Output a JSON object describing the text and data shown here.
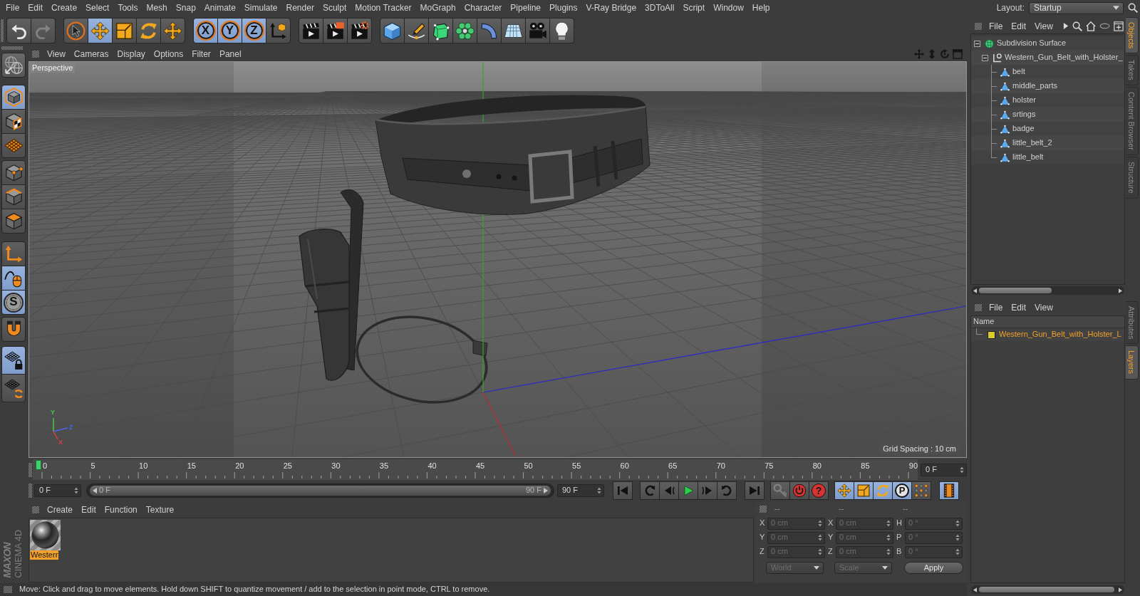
{
  "menu_bar": {
    "items": [
      "File",
      "Edit",
      "Create",
      "Select",
      "Tools",
      "Mesh",
      "Snap",
      "Animate",
      "Simulate",
      "Render",
      "Sculpt",
      "Motion Tracker",
      "MoGraph",
      "Character",
      "Pipeline",
      "Plugins",
      "V-Ray Bridge",
      "3DToAll",
      "Script",
      "Window",
      "Help"
    ],
    "layout_label": "Layout:",
    "layout_value": "Startup"
  },
  "top_toolbar": [
    [
      {
        "on": false,
        "disabled": false
      },
      {
        "on": false,
        "disabled": true
      }
    ],
    [
      {
        "on": false,
        "disabled": false
      },
      {
        "on": true,
        "disabled": false
      },
      {
        "on": false,
        "disabled": false
      },
      {
        "on": false,
        "disabled": false
      },
      {
        "on": false,
        "disabled": false
      }
    ],
    [
      {
        "label": "X",
        "on": true,
        "disabled": false
      },
      {
        "label": "Y",
        "on": true,
        "disabled": false
      },
      {
        "label": "Z",
        "on": true,
        "disabled": false
      },
      {
        "on": false,
        "disabled": false
      }
    ],
    [
      {
        "on": false,
        "disabled": false
      },
      {
        "on": false,
        "disabled": false
      },
      {
        "on": false,
        "disabled": false
      }
    ],
    [
      {
        "on": false,
        "disabled": false
      },
      {
        "on": false,
        "disabled": false
      },
      {
        "on": false,
        "disabled": false
      },
      {
        "on": false,
        "disabled": false
      },
      {
        "on": false,
        "disabled": false
      },
      {
        "on": false,
        "disabled": false
      },
      {
        "on": false,
        "disabled": false
      },
      {
        "on": false,
        "disabled": false
      }
    ]
  ],
  "left_toolbar": [
    [
      {
        "on": false
      }
    ],
    [
      {
        "on": true
      },
      {
        "on": false
      },
      {
        "on": false
      }
    ],
    [
      {
        "on": false
      },
      {
        "on": false
      },
      {
        "on": false
      }
    ],
    [
      {
        "on": false
      },
      {
        "on": true
      },
      {
        "label": "S",
        "on": true
      }
    ],
    [
      {
        "on": false
      }
    ],
    [
      {
        "on": true
      },
      {
        "on": false
      }
    ]
  ],
  "viewport": {
    "menu": [
      "View",
      "Cameras",
      "Display",
      "Options",
      "Filter",
      "Panel"
    ],
    "camera": "Perspective",
    "grid_spacing": "Grid Spacing : 10 cm",
    "gizmo_labels": [
      {
        "text": "Y",
        "color": "#46c846"
      },
      {
        "text": "Z",
        "color": "#4a64f0"
      },
      {
        "text": "X",
        "color": "#dc3c3c"
      }
    ]
  },
  "object_manager": {
    "menu": [
      "File",
      "Edit",
      "View"
    ],
    "objects": [
      {
        "name": "Subdivision Surface",
        "kind": "subdivision",
        "selected": false,
        "expanded": true,
        "children": [
          {
            "name": "Western_Gun_Belt_with_Holster_",
            "kind": "null",
            "selected": false,
            "expanded": true,
            "children": [
              {
                "name": "belt",
                "kind": "polygon",
                "selected": false
              },
              {
                "name": "middle_parts",
                "kind": "polygon",
                "selected": false
              },
              {
                "name": "holster",
                "kind": "polygon",
                "selected": false
              },
              {
                "name": "srtings",
                "kind": "polygon",
                "selected": false
              },
              {
                "name": "badge",
                "kind": "polygon",
                "selected": false
              },
              {
                "name": "little_belt_2",
                "kind": "polygon",
                "selected": false
              },
              {
                "name": "little_belt",
                "kind": "polygon",
                "selected": false
              }
            ]
          }
        ]
      }
    ]
  },
  "side_tabs": {
    "upper": [
      {
        "label": "Objects",
        "selected": true
      },
      {
        "label": "Takes",
        "selected": false
      },
      {
        "label": "Content Browser",
        "selected": false
      },
      {
        "label": "Structure",
        "selected": false
      }
    ],
    "lower": [
      {
        "label": "Attributes",
        "selected": false
      },
      {
        "label": "Layers",
        "selected": true
      }
    ]
  },
  "layer_manager": {
    "menu": [
      "File",
      "Edit",
      "View"
    ],
    "column": "Name",
    "layers": [
      {
        "name": "Western_Gun_Belt_with_Holster_L",
        "color": "#d8cb2a",
        "selected": true
      }
    ]
  },
  "timeline": {
    "labels": [
      "0",
      "5",
      "10",
      "15",
      "20",
      "25",
      "30",
      "35",
      "40",
      "45",
      "50",
      "55",
      "60",
      "65",
      "70",
      "75",
      "80",
      "85",
      "90"
    ],
    "level": 0,
    "frame_field": "0 F"
  },
  "playback": {
    "min_field": "0 F",
    "range": {
      "start": "0 F",
      "end": "90 F",
      "level": 1
    },
    "max_field": "90 F",
    "key_buttons": [
      [
        {
          "on": false,
          "disabled": true
        },
        {
          "on": false,
          "disabled": false
        },
        {
          "label": "?",
          "on": false,
          "disabled": false
        }
      ],
      [
        {
          "on": true,
          "disabled": false
        },
        {
          "on": true,
          "disabled": false
        },
        {
          "on": true,
          "disabled": false
        },
        {
          "label": "P",
          "on": true,
          "disabled": false
        },
        {
          "on": false,
          "disabled": false
        }
      ],
      [
        {
          "on": true,
          "disabled": false
        }
      ]
    ]
  },
  "material_manager": {
    "menu": [
      "Create",
      "Edit",
      "Function",
      "Texture"
    ],
    "materials": [
      {
        "name": "Westerr",
        "selected": true
      }
    ]
  },
  "coordinates": {
    "headers": [
      "--",
      "--",
      "--"
    ],
    "disabled": true,
    "rows": [
      [
        {
          "axis": "X",
          "value": "0 cm"
        },
        {
          "axis": "X",
          "value": "0 cm"
        },
        {
          "axis": "H",
          "value": "0 °"
        }
      ],
      [
        {
          "axis": "Y",
          "value": "0 cm"
        },
        {
          "axis": "Y",
          "value": "0 cm"
        },
        {
          "axis": "P",
          "value": "0 °"
        }
      ],
      [
        {
          "axis": "Z",
          "value": "0 cm"
        },
        {
          "axis": "Z",
          "value": "0 cm"
        },
        {
          "axis": "B",
          "value": "0 °"
        }
      ]
    ],
    "coordinate_mode": "World",
    "size_mode": "Scale",
    "apply": "Apply"
  },
  "logo": {
    "brand": "MAXON",
    "product": "CINEMA 4D"
  },
  "status_bar": {
    "text": "Move: Click and drag to move elements. Hold down SHIFT to quantize movement / add to the selection in point mode, CTRL to remove."
  }
}
